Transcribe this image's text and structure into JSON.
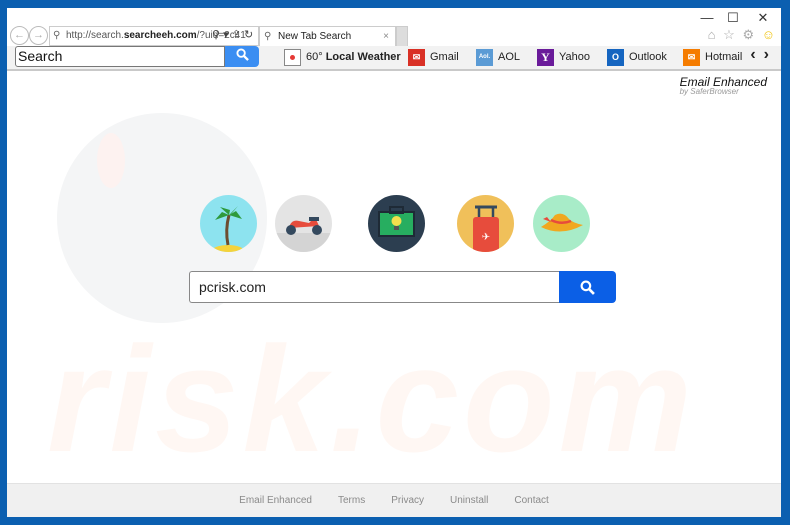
{
  "window": {
    "minimize": "—",
    "maximize": "☐",
    "close": "✕"
  },
  "nav": {
    "back": "←",
    "forward": "→",
    "url_prefix": "http://search.",
    "url_domain": "searcheeh.com",
    "url_suffix": "/?uid=2c41",
    "addr_tools": "⚲ ▾ ⇪ ↻",
    "tab_title": "New Tab Search",
    "tab_close": "×"
  },
  "ie_tools": {
    "home": "⌂",
    "favorites": "☆",
    "settings": "⚙",
    "feedback": "☺"
  },
  "toolbar": {
    "search_value": "Search",
    "weather": "60°",
    "weather_label": "Local Weather",
    "links": [
      {
        "label": "Gmail",
        "icon": "gmail-icon",
        "color": "#d93025",
        "glyph": "✉"
      },
      {
        "label": "AOL",
        "icon": "aol-icon",
        "color": "#5b9bd5",
        "glyph": "Aol."
      },
      {
        "label": "Yahoo",
        "icon": "yahoo-icon",
        "color": "#6a1b9a",
        "glyph": "Y"
      },
      {
        "label": "Outlook",
        "icon": "outlook-icon",
        "color": "#1565c0",
        "glyph": "O"
      },
      {
        "label": "Hotmail",
        "icon": "hotmail-icon",
        "color": "#f57c00",
        "glyph": "✉"
      }
    ],
    "prev": "‹",
    "next": "›"
  },
  "brand": {
    "title": "Email Enhanced",
    "subtitle": "by SaferBrowser"
  },
  "watermark": "risk.com",
  "main_search": {
    "value": "pcrisk.com"
  },
  "icons": [
    {
      "name": "palm-tree-icon",
      "bg": "#8de3ef"
    },
    {
      "name": "scooter-icon",
      "bg": "#e4e4e4"
    },
    {
      "name": "briefcase-lightbulb-icon",
      "bg": "#2c3e50"
    },
    {
      "name": "luggage-icon",
      "bg": "#f0c05a"
    },
    {
      "name": "sun-hat-icon",
      "bg": "#a8ecc8"
    }
  ],
  "footer": [
    "Email Enhanced",
    "Terms",
    "Privacy",
    "Uninstall",
    "Contact"
  ]
}
